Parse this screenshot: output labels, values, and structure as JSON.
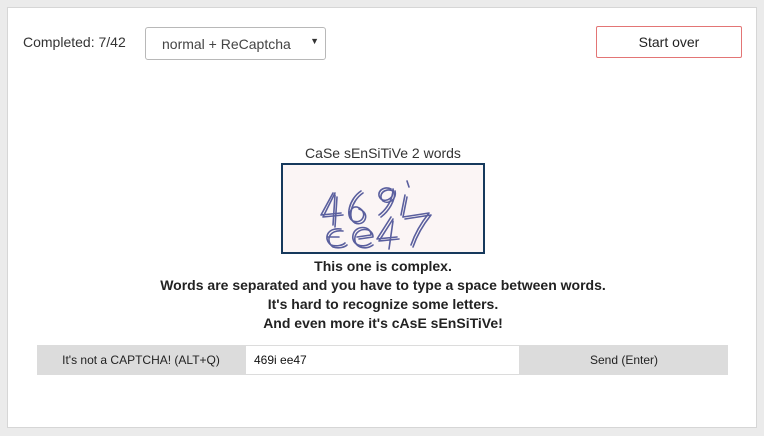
{
  "header": {
    "completed_label": "Completed: 7/42",
    "mode_selected": "normal + ReCaptcha",
    "start_over_label": "Start over"
  },
  "captcha": {
    "caption": "CaSe sEnSiTiVe 2 words",
    "image_text": "469i ee47",
    "ink_color": "#5a5f9e",
    "border_color": "#16395c"
  },
  "instructions": {
    "line1": "This one is complex.",
    "line2": "Words are separated and you have to type a space between words.",
    "line3": "It's hard to recognize some letters.",
    "line4": "And even more it's cAsE sEnSiTiVe!"
  },
  "answer": {
    "not_captcha_label": "It's not a CAPTCHA! (ALT+Q)",
    "input_value": "469i ee47",
    "send_label": "Send (Enter)"
  },
  "colors": {
    "start_over_border": "#e37575",
    "button_bg": "#dcdcdc"
  }
}
